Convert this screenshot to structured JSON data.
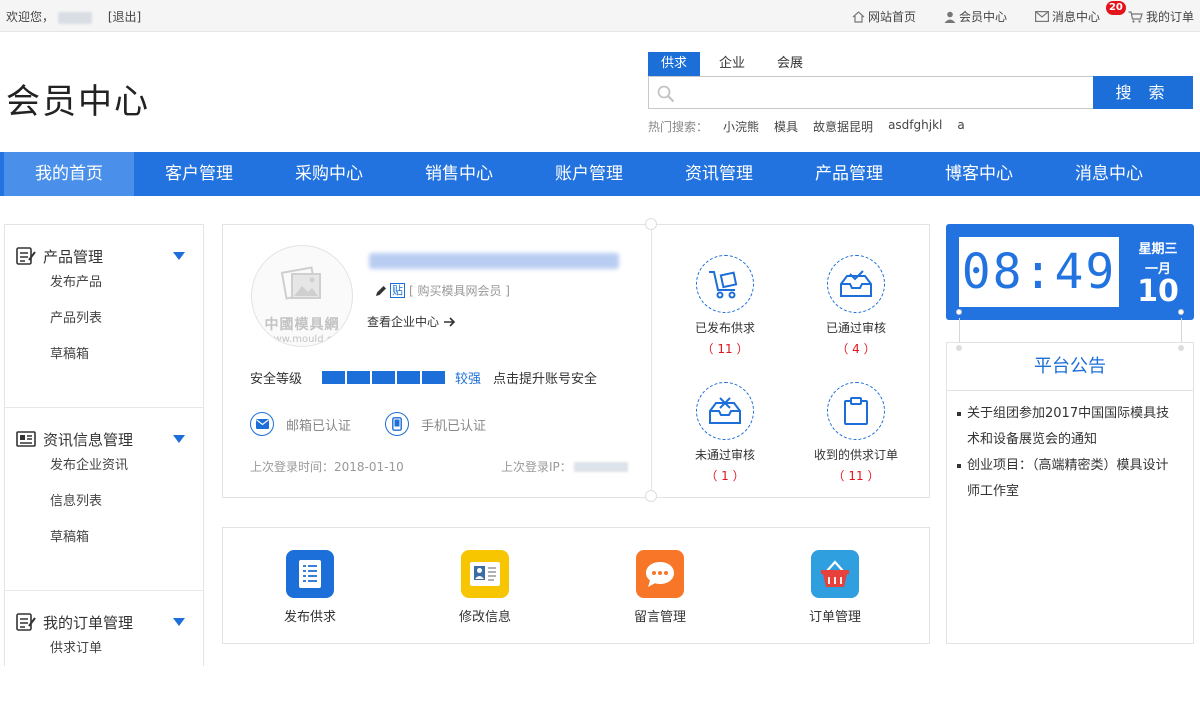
{
  "topbar": {
    "welcome": "欢迎您，",
    "logout": "[退出]",
    "links": [
      {
        "label": "网站首页",
        "icon": "home-icon"
      },
      {
        "label": "会员中心",
        "icon": "user-icon"
      },
      {
        "label": "消息中心",
        "icon": "mail-icon",
        "badge": "20"
      },
      {
        "label": "我的订单",
        "icon": "cart-icon"
      }
    ]
  },
  "header": {
    "title": "会员中心"
  },
  "search": {
    "tabs": [
      "供求",
      "企业",
      "会展"
    ],
    "active_tab": 0,
    "placeholder": "",
    "button": "搜 索",
    "hot_label": "热门搜索：",
    "hot_items": [
      "小浣熊",
      "模具",
      "故意据昆明",
      "asdfghjkl",
      "a"
    ]
  },
  "nav": {
    "items": [
      "我的首页",
      "客户管理",
      "采购中心",
      "销售中心",
      "账户管理",
      "资讯管理",
      "产品管理",
      "博客中心",
      "消息中心"
    ],
    "active": 0
  },
  "sidebar": {
    "groups": [
      {
        "title": "产品管理",
        "icon": "product-icon",
        "items": [
          "发布产品",
          "产品列表",
          "草稿箱"
        ]
      },
      {
        "title": "资讯信息管理",
        "icon": "news-icon",
        "items": [
          "发布企业资讯",
          "信息列表",
          "草稿箱"
        ]
      },
      {
        "title": "我的订单管理",
        "icon": "order-icon",
        "items": [
          "供求订单"
        ]
      }
    ]
  },
  "profile": {
    "avatar_logo": "中國模具網",
    "avatar_url": "www.mould.cn",
    "tie_label": "贴",
    "buy_member": "[ 购买模具网会员 ]",
    "view_company": "查看企业中心",
    "safety_label": "安全等级",
    "safety_level": "较强",
    "safety_tip": "点击提升账号安全",
    "safety_bars": 5,
    "email_verified": "邮箱已认证",
    "phone_verified": "手机已认证",
    "last_login_label": "上次登录时间：",
    "last_login_date": "2018-01-10",
    "last_ip_label": "上次登录IP："
  },
  "stats": [
    {
      "label": "已发布供求",
      "count": "（ 11 ）",
      "icon": "cart-box-icon"
    },
    {
      "label": "已通过审核",
      "count": "（ 4 ）",
      "icon": "approved-tray-icon"
    },
    {
      "label": "未通过审核",
      "count": "（ 1 ）",
      "icon": "rejected-tray-icon"
    },
    {
      "label": "收到的供求订单",
      "count": "（ 11 ）",
      "icon": "clipboard-icon"
    }
  ],
  "quick": [
    {
      "label": "发布供求",
      "icon": "document-list-icon",
      "color": "#1c6fd8"
    },
    {
      "label": "修改信息",
      "icon": "id-card-icon",
      "color": "#f7c600"
    },
    {
      "label": "留言管理",
      "icon": "chat-bubble-icon",
      "color": "#f77628"
    },
    {
      "label": "订单管理",
      "icon": "basket-icon",
      "color": "#2f9fe0"
    }
  ],
  "clock": {
    "time": "08:49",
    "weekday": "星期三",
    "month": "一月",
    "day": "10"
  },
  "notice": {
    "title": "平台公告",
    "items": [
      "关于组团参加2017中国国际模具技术和设备展览会的通知",
      "创业项目：（高端精密类）模具设计师工作室"
    ]
  },
  "colors": {
    "primary": "#2273e0",
    "accent": "#1c6fd8",
    "alert": "#e4141b"
  }
}
